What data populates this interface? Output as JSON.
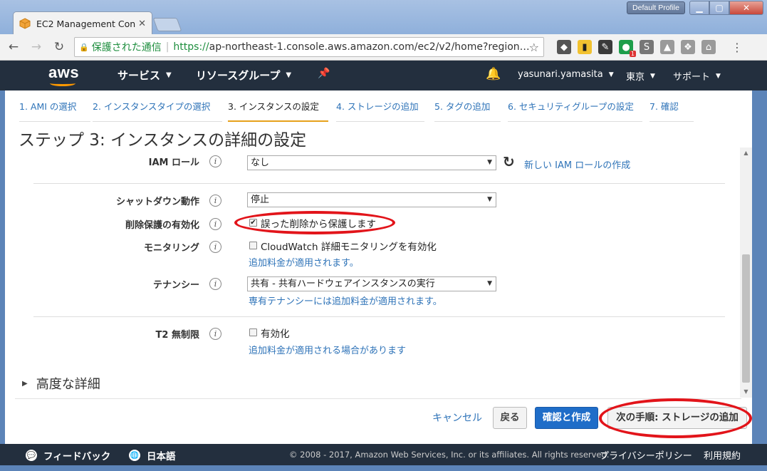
{
  "browser": {
    "tab_title": "EC2 Management Con",
    "profile": "Default Profile",
    "omnibox": {
      "secure_text": "保護された通信",
      "url_scheme": "https://",
      "url_rest": "ap-northeast-1.console.aws.amazon.com/ec2/v2/home?region…"
    },
    "ext_badge": "1"
  },
  "aws_header": {
    "logo": "aws",
    "services": "サービス",
    "resource_groups": "リソースグループ",
    "user": "yasunari.yamasita",
    "region": "東京",
    "support": "サポート"
  },
  "steps": [
    {
      "label": "1. AMI の選択"
    },
    {
      "label": "2. インスタンスタイプの選択"
    },
    {
      "label": "3. インスタンスの設定"
    },
    {
      "label": "4. ストレージの追加"
    },
    {
      "label": "5. タグの追加"
    },
    {
      "label": "6. セキュリティグループの設定"
    },
    {
      "label": "7. 確認"
    }
  ],
  "page_title": "ステップ 3: インスタンスの詳細の設定",
  "form": {
    "iam_role": {
      "label": "IAM ロール",
      "value": "なし",
      "create_link": "新しい IAM ロールの作成"
    },
    "shutdown": {
      "label": "シャットダウン動作",
      "value": "停止"
    },
    "termination": {
      "label": "削除保護の有効化",
      "checkbox": "誤った削除から保護します",
      "checked": true
    },
    "monitoring": {
      "label": "モニタリング",
      "checkbox": "CloudWatch 詳細モニタリングを有効化",
      "note": "追加料金が適用されます。"
    },
    "tenancy": {
      "label": "テナンシー",
      "value": "共有 - 共有ハードウェアインスタンスの実行",
      "note": "専有テナンシーには追加料金が適用されます。"
    },
    "t2": {
      "label": "T2 無制限",
      "checkbox": "有効化",
      "note": "追加料金が適用される場合があります"
    },
    "info_glyph": "i"
  },
  "advanced": "高度な詳細",
  "actions": {
    "cancel": "キャンセル",
    "back": "戻る",
    "review": "確認と作成",
    "next": "次の手順: ストレージの追加"
  },
  "footer": {
    "feedback": "フィードバック",
    "language": "日本語",
    "copyright": "© 2008 - 2017, Amazon Web Services, Inc. or its affiliates. All rights reserved.",
    "privacy": "プライバシーポリシー",
    "terms": "利用規約"
  }
}
